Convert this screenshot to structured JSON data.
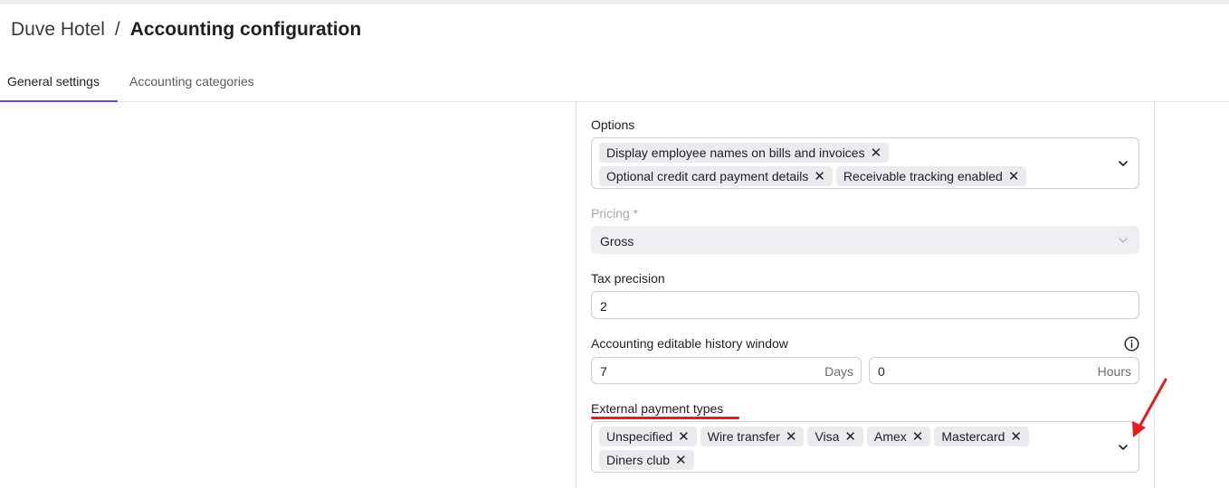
{
  "breadcrumb": {
    "parent": "Duve Hotel",
    "separator": "/",
    "current": "Accounting configuration"
  },
  "tabs": [
    {
      "label": "General settings",
      "active": true
    },
    {
      "label": "Accounting categories",
      "active": false
    }
  ],
  "form": {
    "options": {
      "label": "Options",
      "chips_row1": [
        "Display employee names on bills and invoices"
      ],
      "chips_row2": [
        "Optional credit card payment details",
        "Receivable tracking enabled"
      ],
      "remove_glyph": "✕"
    },
    "pricing": {
      "label": "Pricing *",
      "value": "Gross",
      "disabled": true
    },
    "tax_precision": {
      "label": "Tax precision",
      "value": "2"
    },
    "history_window": {
      "label": "Accounting editable history window",
      "days_value": "7",
      "days_suffix": "Days",
      "hours_value": "0",
      "hours_suffix": "Hours",
      "info_icon": "info-icon"
    },
    "external_payment_types": {
      "label": "External payment types",
      "chips_row1": [
        "Unspecified",
        "Wire transfer",
        "Visa",
        "Amex",
        "Mastercard"
      ],
      "chips_row2": [
        "Diners club"
      ]
    }
  },
  "annotations": {
    "underline_color": "#e11d1d",
    "arrow_color": "#e11d1d"
  },
  "colors": {
    "accent": "#6b4fd8",
    "chip_bg": "#ebeaef",
    "border": "#cfcdd6"
  }
}
